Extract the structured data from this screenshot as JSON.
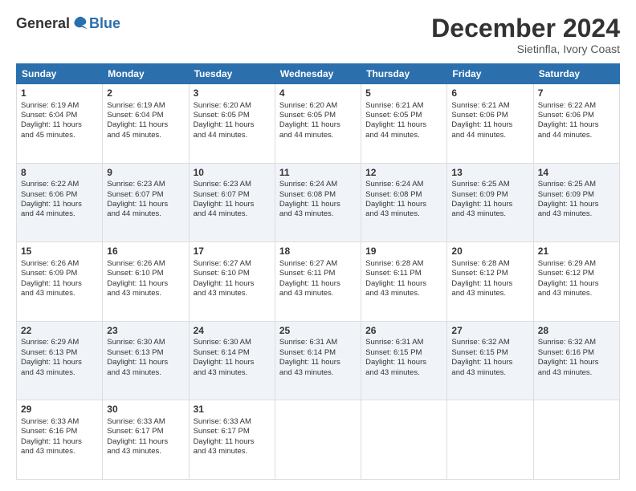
{
  "logo": {
    "general": "General",
    "blue": "Blue"
  },
  "header": {
    "month_title": "December 2024",
    "location": "Sietinfla, Ivory Coast"
  },
  "days_of_week": [
    "Sunday",
    "Monday",
    "Tuesday",
    "Wednesday",
    "Thursday",
    "Friday",
    "Saturday"
  ],
  "weeks": [
    [
      {
        "day": 1,
        "lines": [
          "Sunrise: 6:19 AM",
          "Sunset: 6:04 PM",
          "Daylight: 11 hours",
          "and 45 minutes."
        ]
      },
      {
        "day": 2,
        "lines": [
          "Sunrise: 6:19 AM",
          "Sunset: 6:04 PM",
          "Daylight: 11 hours",
          "and 45 minutes."
        ]
      },
      {
        "day": 3,
        "lines": [
          "Sunrise: 6:20 AM",
          "Sunset: 6:05 PM",
          "Daylight: 11 hours",
          "and 44 minutes."
        ]
      },
      {
        "day": 4,
        "lines": [
          "Sunrise: 6:20 AM",
          "Sunset: 6:05 PM",
          "Daylight: 11 hours",
          "and 44 minutes."
        ]
      },
      {
        "day": 5,
        "lines": [
          "Sunrise: 6:21 AM",
          "Sunset: 6:05 PM",
          "Daylight: 11 hours",
          "and 44 minutes."
        ]
      },
      {
        "day": 6,
        "lines": [
          "Sunrise: 6:21 AM",
          "Sunset: 6:06 PM",
          "Daylight: 11 hours",
          "and 44 minutes."
        ]
      },
      {
        "day": 7,
        "lines": [
          "Sunrise: 6:22 AM",
          "Sunset: 6:06 PM",
          "Daylight: 11 hours",
          "and 44 minutes."
        ]
      }
    ],
    [
      {
        "day": 8,
        "lines": [
          "Sunrise: 6:22 AM",
          "Sunset: 6:06 PM",
          "Daylight: 11 hours",
          "and 44 minutes."
        ]
      },
      {
        "day": 9,
        "lines": [
          "Sunrise: 6:23 AM",
          "Sunset: 6:07 PM",
          "Daylight: 11 hours",
          "and 44 minutes."
        ]
      },
      {
        "day": 10,
        "lines": [
          "Sunrise: 6:23 AM",
          "Sunset: 6:07 PM",
          "Daylight: 11 hours",
          "and 44 minutes."
        ]
      },
      {
        "day": 11,
        "lines": [
          "Sunrise: 6:24 AM",
          "Sunset: 6:08 PM",
          "Daylight: 11 hours",
          "and 43 minutes."
        ]
      },
      {
        "day": 12,
        "lines": [
          "Sunrise: 6:24 AM",
          "Sunset: 6:08 PM",
          "Daylight: 11 hours",
          "and 43 minutes."
        ]
      },
      {
        "day": 13,
        "lines": [
          "Sunrise: 6:25 AM",
          "Sunset: 6:09 PM",
          "Daylight: 11 hours",
          "and 43 minutes."
        ]
      },
      {
        "day": 14,
        "lines": [
          "Sunrise: 6:25 AM",
          "Sunset: 6:09 PM",
          "Daylight: 11 hours",
          "and 43 minutes."
        ]
      }
    ],
    [
      {
        "day": 15,
        "lines": [
          "Sunrise: 6:26 AM",
          "Sunset: 6:09 PM",
          "Daylight: 11 hours",
          "and 43 minutes."
        ]
      },
      {
        "day": 16,
        "lines": [
          "Sunrise: 6:26 AM",
          "Sunset: 6:10 PM",
          "Daylight: 11 hours",
          "and 43 minutes."
        ]
      },
      {
        "day": 17,
        "lines": [
          "Sunrise: 6:27 AM",
          "Sunset: 6:10 PM",
          "Daylight: 11 hours",
          "and 43 minutes."
        ]
      },
      {
        "day": 18,
        "lines": [
          "Sunrise: 6:27 AM",
          "Sunset: 6:11 PM",
          "Daylight: 11 hours",
          "and 43 minutes."
        ]
      },
      {
        "day": 19,
        "lines": [
          "Sunrise: 6:28 AM",
          "Sunset: 6:11 PM",
          "Daylight: 11 hours",
          "and 43 minutes."
        ]
      },
      {
        "day": 20,
        "lines": [
          "Sunrise: 6:28 AM",
          "Sunset: 6:12 PM",
          "Daylight: 11 hours",
          "and 43 minutes."
        ]
      },
      {
        "day": 21,
        "lines": [
          "Sunrise: 6:29 AM",
          "Sunset: 6:12 PM",
          "Daylight: 11 hours",
          "and 43 minutes."
        ]
      }
    ],
    [
      {
        "day": 22,
        "lines": [
          "Sunrise: 6:29 AM",
          "Sunset: 6:13 PM",
          "Daylight: 11 hours",
          "and 43 minutes."
        ]
      },
      {
        "day": 23,
        "lines": [
          "Sunrise: 6:30 AM",
          "Sunset: 6:13 PM",
          "Daylight: 11 hours",
          "and 43 minutes."
        ]
      },
      {
        "day": 24,
        "lines": [
          "Sunrise: 6:30 AM",
          "Sunset: 6:14 PM",
          "Daylight: 11 hours",
          "and 43 minutes."
        ]
      },
      {
        "day": 25,
        "lines": [
          "Sunrise: 6:31 AM",
          "Sunset: 6:14 PM",
          "Daylight: 11 hours",
          "and 43 minutes."
        ]
      },
      {
        "day": 26,
        "lines": [
          "Sunrise: 6:31 AM",
          "Sunset: 6:15 PM",
          "Daylight: 11 hours",
          "and 43 minutes."
        ]
      },
      {
        "day": 27,
        "lines": [
          "Sunrise: 6:32 AM",
          "Sunset: 6:15 PM",
          "Daylight: 11 hours",
          "and 43 minutes."
        ]
      },
      {
        "day": 28,
        "lines": [
          "Sunrise: 6:32 AM",
          "Sunset: 6:16 PM",
          "Daylight: 11 hours",
          "and 43 minutes."
        ]
      }
    ],
    [
      {
        "day": 29,
        "lines": [
          "Sunrise: 6:33 AM",
          "Sunset: 6:16 PM",
          "Daylight: 11 hours",
          "and 43 minutes."
        ]
      },
      {
        "day": 30,
        "lines": [
          "Sunrise: 6:33 AM",
          "Sunset: 6:17 PM",
          "Daylight: 11 hours",
          "and 43 minutes."
        ]
      },
      {
        "day": 31,
        "lines": [
          "Sunrise: 6:33 AM",
          "Sunset: 6:17 PM",
          "Daylight: 11 hours",
          "and 43 minutes."
        ]
      },
      null,
      null,
      null,
      null
    ]
  ]
}
